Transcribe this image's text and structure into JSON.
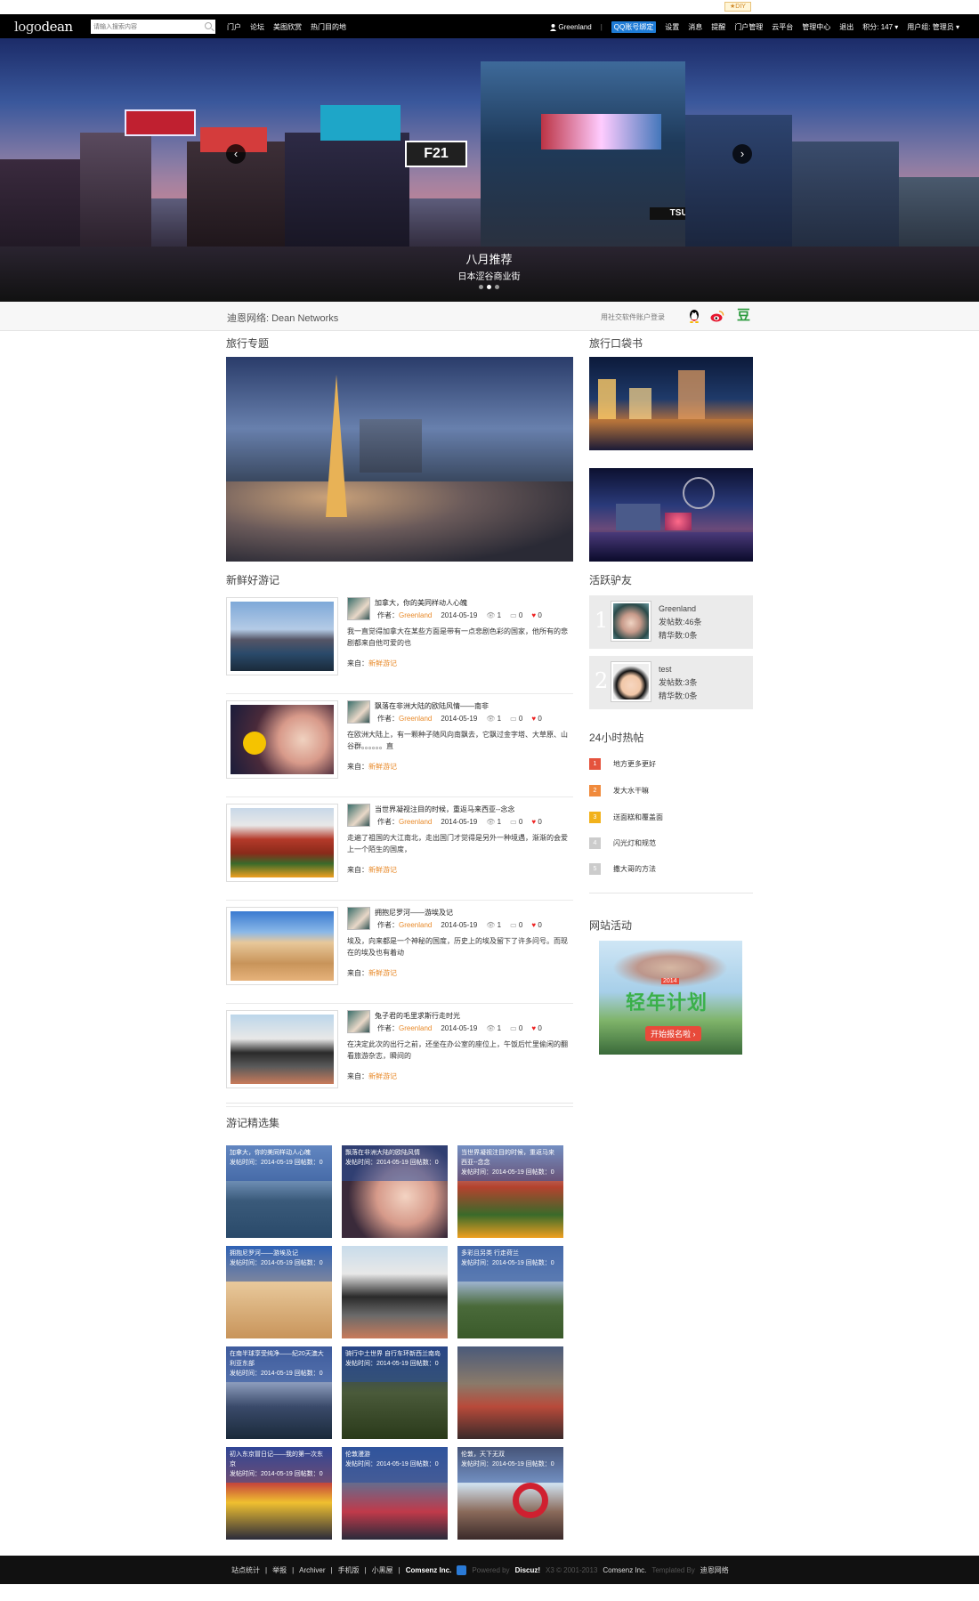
{
  "diy": {
    "label": "★DIY"
  },
  "topnav": {
    "logo_light": "logo",
    "logo_bold": "dean",
    "search_placeholder": "请输入搜索内容",
    "links": [
      "门户",
      "论坛",
      "美图欣赏",
      "热门目的地"
    ],
    "user": "Greenland",
    "qq_bind": "QQ账号绑定",
    "right_links": [
      "设置",
      "消息",
      "提醒",
      "门户管理",
      "云平台",
      "管理中心",
      "退出"
    ],
    "credits": "积分: 147",
    "usergroup": "用户组: 管理员"
  },
  "hero": {
    "title": "八月推荐",
    "subtitle": "日本涩谷商业街",
    "prev": "‹",
    "next": "›",
    "sign_f21": "F21",
    "sign_tsutaya": "TSUTAYA"
  },
  "sitebar": {
    "name": "迪恩网络: Dean Networks",
    "login_hint": "用社交软件账户登录",
    "social": [
      "qq-icon",
      "weibo-icon",
      "douban-icon"
    ],
    "douban_glyph": "豆"
  },
  "sections": {
    "travel_topic": "旅行专题",
    "pocketbook": "旅行口袋书",
    "fresh_notes": "新鲜好游记",
    "active_friends": "活跃驴友",
    "hot24": "24小时热帖",
    "activity": "网站活动",
    "collection": "游记精选集"
  },
  "articles": [
    {
      "title": "加拿大，你的美同样动人心魄",
      "author_label": "作者：",
      "author": "Greenland",
      "date": "2014-05-19",
      "views": "1",
      "comments": "0",
      "likes": "0",
      "summary": "我一直觉得加拿大在某些方面是带有一点悲剧色彩的国家，他所有的悲剧都来自他可爱的也",
      "src_label": "来自：",
      "src": "新鲜游记"
    },
    {
      "title": "飘落在非洲大陆的欧陆风情——南非",
      "author_label": "作者：",
      "author": "Greenland",
      "date": "2014-05-19",
      "views": "1",
      "comments": "0",
      "likes": "0",
      "summary": "在欧洲大陆上，有一颗种子随风向南飘去，它飘过金字塔、大草原、山谷群。。。。。。直",
      "src_label": "来自：",
      "src": "新鲜游记"
    },
    {
      "title": "当世界凝视注目的时候，重返马来西亚--念念",
      "author_label": "作者：",
      "author": "Greenland",
      "date": "2014-05-19",
      "views": "1",
      "comments": "0",
      "likes": "0",
      "summary": "走遍了祖国的大江南北，走出国门才觉得是另外一种境遇，渐渐的会爱上一个陌生的国度，",
      "src_label": "来自：",
      "src": "新鲜游记"
    },
    {
      "title": "拥抱尼罗河——游埃及记",
      "author_label": "作者：",
      "author": "Greenland",
      "date": "2014-05-19",
      "views": "1",
      "comments": "0",
      "likes": "0",
      "summary": "埃及，向来都是一个神秘的国度，历史上的埃及留下了许多问号。而现在的埃及也有着动",
      "src_label": "来自：",
      "src": "新鲜游记"
    },
    {
      "title": "兔子君的毛里求斯行走时光",
      "author_label": "作者：",
      "author": "Greenland",
      "date": "2014-05-19",
      "views": "1",
      "comments": "0",
      "likes": "0",
      "summary": "在决定此次的出行之前，还坐在办公室的座位上，午饭后忙里偷闲的翻看旅游杂志，瞬间的",
      "src_label": "来自：",
      "src": "新鲜游记"
    }
  ],
  "friends": [
    {
      "rank": "1",
      "name": "Greenland",
      "posts": "发帖数:46条",
      "digest": "精华数:0条"
    },
    {
      "rank": "2",
      "name": "test",
      "posts": "发帖数:3条",
      "digest": "精华数:0条"
    }
  ],
  "hot": [
    {
      "rank": "1",
      "title": "地方更多更好",
      "color": "#e5533d"
    },
    {
      "rank": "2",
      "title": "发大水干嘛",
      "color": "#f08a3c"
    },
    {
      "rank": "3",
      "title": "送面糕和覆盖面",
      "color": "#f2b21c"
    },
    {
      "rank": "4",
      "title": "闪光灯和规范",
      "color": "#cccccc"
    },
    {
      "rank": "5",
      "title": "撒大哥的方法",
      "color": "#cccccc"
    }
  ],
  "activity": {
    "title": "轻年计划",
    "year": "2014",
    "button": "开始报名啦 ›"
  },
  "gallery": [
    {
      "title": "加拿大，你的美同样动人心魄",
      "meta": "发帖时间：2014-05-19 回帖数：0"
    },
    {
      "title": "飘落在非洲大陆的欧陆风情",
      "meta": "发帖时间：2014-05-19 回帖数：0"
    },
    {
      "title": "当世界凝视注目的时候，重返马来西亚--念念",
      "meta": "发帖时间：2014-05-19 回帖数：0"
    },
    {
      "title": "拥抱尼罗河——游埃及记",
      "meta": "发帖时间：2014-05-19 回帖数：0"
    },
    {
      "title": "",
      "meta": ""
    },
    {
      "title": "多彩且另类 行走荷兰",
      "meta": "发帖时间：2014-05-19 回帖数：0"
    },
    {
      "title": "在南半球享受纯净——纪20天澳大利亚东部",
      "meta": "发帖时间：2014-05-19 回帖数：0"
    },
    {
      "title": "骑行中土世界 自行车环新西兰南岛",
      "meta": "发帖时间：2014-05-19 回帖数：0"
    },
    {
      "title": "",
      "meta": ""
    },
    {
      "title": "初入东京冒日记——我的第一次东京",
      "meta": "发帖时间：2014-05-19 回帖数：0"
    },
    {
      "title": "伦敦漫游",
      "meta": "发帖时间：2014-05-19 回帖数：0"
    },
    {
      "title": "伦敦，天下无双",
      "meta": "发帖时间：2014-05-19 回帖数：0"
    }
  ],
  "footer": {
    "links": [
      "站点统计",
      "|",
      "举报",
      "|",
      "Archiver",
      "|",
      "手机版",
      "|",
      "小黑屋",
      "|"
    ],
    "company": "Comsenz Inc.",
    "powered": "Powered by",
    "discuz": "Discuz!",
    "copyright": "X3 © 2001-2013",
    "company2": "Comsenz Inc.",
    "templated": "Templated By",
    "dean": "迪恩网络"
  }
}
